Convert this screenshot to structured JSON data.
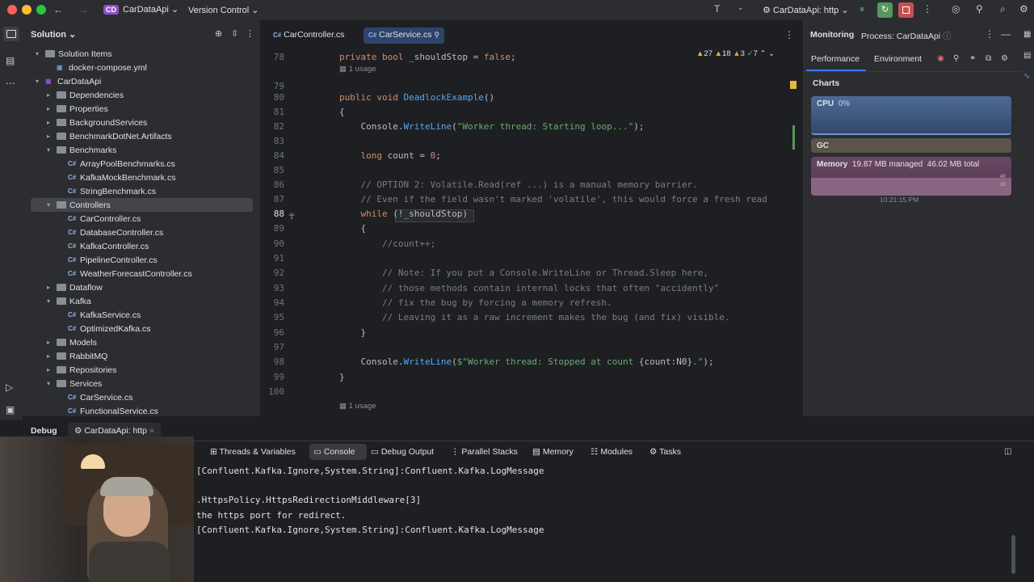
{
  "titlebar": {
    "project_badge": "CD",
    "project_name": "CarDataApi",
    "vcs_label": "Version Control",
    "run_config": "CarDataApi: http"
  },
  "sidebar": {
    "title": "Solution",
    "rows": [
      {
        "label": "Solution Items",
        "depth": 1,
        "kind": "folder",
        "open": true
      },
      {
        "label": "docker-compose.yml",
        "depth": 2,
        "kind": "file"
      },
      {
        "label": "CarDataApi",
        "depth": 1,
        "kind": "project",
        "open": true
      },
      {
        "label": "Dependencies",
        "depth": 2,
        "kind": "folder",
        "open": false
      },
      {
        "label": "Properties",
        "depth": 2,
        "kind": "folder",
        "open": false
      },
      {
        "label": "BackgroundServices",
        "depth": 2,
        "kind": "folder",
        "open": false
      },
      {
        "label": "BenchmarkDotNet.Artifacts",
        "depth": 2,
        "kind": "folder",
        "open": false
      },
      {
        "label": "Benchmarks",
        "depth": 2,
        "kind": "folder",
        "open": true
      },
      {
        "label": "ArrayPoolBenchmarks.cs",
        "depth": 3,
        "kind": "cs"
      },
      {
        "label": "KafkaMockBenchmark.cs",
        "depth": 3,
        "kind": "cs"
      },
      {
        "label": "StringBenchmark.cs",
        "depth": 3,
        "kind": "cs"
      },
      {
        "label": "Controllers",
        "depth": 2,
        "kind": "folder",
        "open": true,
        "selected": true
      },
      {
        "label": "CarController.cs",
        "depth": 3,
        "kind": "cs"
      },
      {
        "label": "DatabaseController.cs",
        "depth": 3,
        "kind": "cs"
      },
      {
        "label": "KafkaController.cs",
        "depth": 3,
        "kind": "cs"
      },
      {
        "label": "PipelineController.cs",
        "depth": 3,
        "kind": "cs"
      },
      {
        "label": "WeatherForecastController.cs",
        "depth": 3,
        "kind": "cs"
      },
      {
        "label": "Dataflow",
        "depth": 2,
        "kind": "folder",
        "open": false
      },
      {
        "label": "Kafka",
        "depth": 2,
        "kind": "folder",
        "open": true
      },
      {
        "label": "KafkaService.cs",
        "depth": 3,
        "kind": "cs"
      },
      {
        "label": "OptimizedKafka.cs",
        "depth": 3,
        "kind": "cs"
      },
      {
        "label": "Models",
        "depth": 2,
        "kind": "folder",
        "open": false
      },
      {
        "label": "RabbitMQ",
        "depth": 2,
        "kind": "folder",
        "open": false
      },
      {
        "label": "Repositories",
        "depth": 2,
        "kind": "folder",
        "open": false
      },
      {
        "label": "Services",
        "depth": 2,
        "kind": "folder",
        "open": true
      },
      {
        "label": "CarService.cs",
        "depth": 3,
        "kind": "cs"
      },
      {
        "label": "FunctionalService.cs",
        "depth": 3,
        "kind": "cs"
      }
    ]
  },
  "editor": {
    "tabs": [
      {
        "label": "CarController.cs",
        "active": false
      },
      {
        "label": "CarService.cs",
        "active": true
      }
    ],
    "inspections": {
      "warnings": "27",
      "weak": "18",
      "info": "3",
      "typos": "7"
    },
    "usage_label": "1 usage",
    "lines": [
      {
        "n": "78",
        "tokens": [
          [
            "kw",
            "private "
          ],
          [
            "kw",
            "bool "
          ],
          [
            "id",
            "_shouldStop = "
          ],
          [
            "kw",
            "false"
          ],
          [
            "id",
            ";"
          ]
        ]
      },
      {
        "n": "79",
        "tokens": []
      },
      {
        "n": "80",
        "tokens": [
          [
            "kw",
            "public "
          ],
          [
            "kw",
            "void "
          ],
          [
            "fn",
            "DeadlockExample"
          ],
          [
            "id",
            "()"
          ]
        ]
      },
      {
        "n": "81",
        "tokens": [
          [
            "id",
            "{"
          ]
        ]
      },
      {
        "n": "82",
        "tokens": [
          [
            "id",
            "    Console."
          ],
          [
            "fn",
            "WriteLine"
          ],
          [
            "id",
            "("
          ],
          [
            "str",
            "\"Worker thread: Starting loop...\""
          ],
          [
            "id",
            ");"
          ]
        ]
      },
      {
        "n": "83",
        "tokens": []
      },
      {
        "n": "84",
        "tokens": [
          [
            "kw",
            "    long "
          ],
          [
            "id",
            "count = "
          ],
          [
            "fld",
            "0"
          ],
          [
            "id",
            ";"
          ]
        ]
      },
      {
        "n": "85",
        "tokens": []
      },
      {
        "n": "86",
        "tokens": [
          [
            "cm",
            "    // OPTION 2: Volatile.Read(ref ...) is a manual memory barrier."
          ]
        ]
      },
      {
        "n": "87",
        "tokens": [
          [
            "cm",
            "    // Even if the field wasn't marked 'volatile', this would force a fresh read"
          ]
        ]
      },
      {
        "n": "88",
        "tokens": [
          [
            "kw",
            "    while "
          ],
          [
            "id",
            "(!_shouldStop)"
          ]
        ]
      },
      {
        "n": "89",
        "tokens": [
          [
            "id",
            "    {"
          ]
        ]
      },
      {
        "n": "90",
        "tokens": [
          [
            "cm",
            "        //count++;"
          ]
        ]
      },
      {
        "n": "91",
        "tokens": []
      },
      {
        "n": "92",
        "tokens": [
          [
            "cm",
            "        // Note: If you put a Console.WriteLine or Thread.Sleep here,"
          ]
        ]
      },
      {
        "n": "93",
        "tokens": [
          [
            "cm",
            "        // those methods contain internal locks that often \"accidently\""
          ]
        ]
      },
      {
        "n": "94",
        "tokens": [
          [
            "cm",
            "        // fix the bug by forcing a memory refresh."
          ]
        ]
      },
      {
        "n": "95",
        "tokens": [
          [
            "cm",
            "        // Leaving it as a raw increment makes the bug (and fix) visible."
          ]
        ]
      },
      {
        "n": "96",
        "tokens": [
          [
            "id",
            "    }"
          ]
        ]
      },
      {
        "n": "97",
        "tokens": []
      },
      {
        "n": "98",
        "tokens": [
          [
            "id",
            "    Console."
          ],
          [
            "fn",
            "WriteLine"
          ],
          [
            "id",
            "("
          ],
          [
            "str",
            "$\"Worker thread: Stopped at count "
          ],
          [
            "id",
            "{count:N0}"
          ],
          [
            "str",
            ".\""
          ],
          [
            "id",
            ");"
          ]
        ]
      },
      {
        "n": "99",
        "tokens": [
          [
            "id",
            "}"
          ]
        ]
      },
      {
        "n": "100",
        "tokens": []
      }
    ]
  },
  "monitor": {
    "title": "Monitoring",
    "process": "Process: CarDataApi",
    "tab_performance": "Performance",
    "tab_environment": "Environment",
    "charts_heading": "Charts",
    "cpu_label": "CPU",
    "cpu_value": "0%",
    "gc_label": "GC",
    "memory_label": "Memory",
    "memory_managed": "19.87 MB managed",
    "memory_total": "46.02 MB total",
    "axis_40": "40",
    "axis_20": "20",
    "timestamp": "10:21:15 PM"
  },
  "debug": {
    "title": "Debug",
    "session": "CarDataApi: http",
    "tabs": [
      "Threads & Variables",
      "Console",
      "Debug Output",
      "Parallel Stacks",
      "Memory",
      "Modules",
      "Tasks"
    ],
    "active_tab": "Console",
    "console_lines": [
      "[Confluent.Kafka.Ignore,System.String]:Confluent.Kafka.LogMessage",
      "",
      ".HttpsPolicy.HttpsRedirectionMiddleware[3]",
      "the https port for redirect.",
      "[Confluent.Kafka.Ignore,System.String]:Confluent.Kafka.LogMessage"
    ]
  },
  "colors": {
    "accent": "#3574f0",
    "purple_badge": "#8e4fc7",
    "keyword": "#cf8e6d",
    "string": "#6aab73",
    "comment": "#7a7e85",
    "method": "#56a8f5"
  }
}
